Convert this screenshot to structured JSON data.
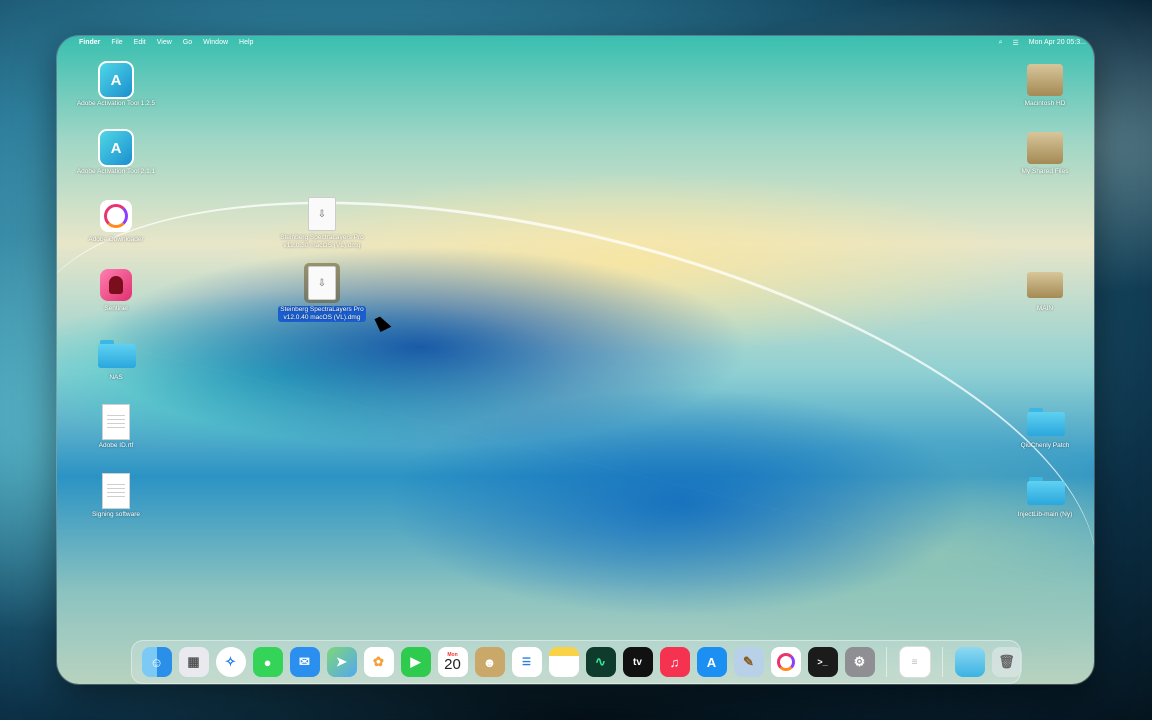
{
  "menubar": {
    "app": "Finder",
    "items": [
      "File",
      "Edit",
      "View",
      "Go",
      "Window",
      "Help"
    ],
    "datetime": "Mon Apr 20 05:3..."
  },
  "desktop": {
    "left_icons": [
      {
        "label": "Adobe Activation Tool 1.2.5",
        "icon": "adobe-activation-tool-icon"
      },
      {
        "label": "Adobe Activation Tool 2.1.1",
        "icon": "adobe-activation-tool-icon"
      },
      {
        "label": "Adobe Downloader",
        "icon": "creative-cloud-icon"
      },
      {
        "label": "Sentinel",
        "icon": "sentinel-icon"
      },
      {
        "label": "NAS",
        "icon": "folder-icon"
      },
      {
        "label": "Adobe ID.rtf",
        "icon": "document-icon"
      },
      {
        "label": "Signing software",
        "icon": "document-icon"
      }
    ],
    "right_icons": [
      {
        "label": "Macintosh HD",
        "icon": "hard-drive-icon"
      },
      {
        "label": "My Shared Files",
        "icon": "hard-drive-icon"
      },
      {
        "label": "MAIN",
        "icon": "hard-drive-icon"
      },
      {
        "label": "QiuChenly Patch",
        "icon": "folder-icon"
      },
      {
        "label": "InjectLib-main (Ny)",
        "icon": "folder-icon"
      }
    ],
    "files": [
      {
        "line1": "Steinberg SpectraLayers Pro",
        "line2": "v12.0.30 macOS (VL).dmg",
        "selected": false
      },
      {
        "line1": "Steinberg SpectraLayers Pro",
        "line2": "v12.0.40 macOS (VL).dmg",
        "selected": true
      }
    ]
  },
  "dock": {
    "calendar": {
      "month": "Mon",
      "day": "20"
    },
    "items": [
      "finder-icon",
      "launchpad-icon",
      "safari-icon",
      "messages-icon",
      "mail-icon",
      "maps-icon",
      "photos-icon",
      "facetime-icon",
      "calendar-icon",
      "contacts-icon",
      "reminders-icon",
      "notes-icon",
      "activity-monitor-icon",
      "apple-tv-icon",
      "music-icon",
      "app-store-icon",
      "script-editor-icon",
      "creative-cloud-icon",
      "terminal-icon",
      "system-settings-icon"
    ],
    "tv_label": "tv",
    "terminal_label": ">_"
  }
}
